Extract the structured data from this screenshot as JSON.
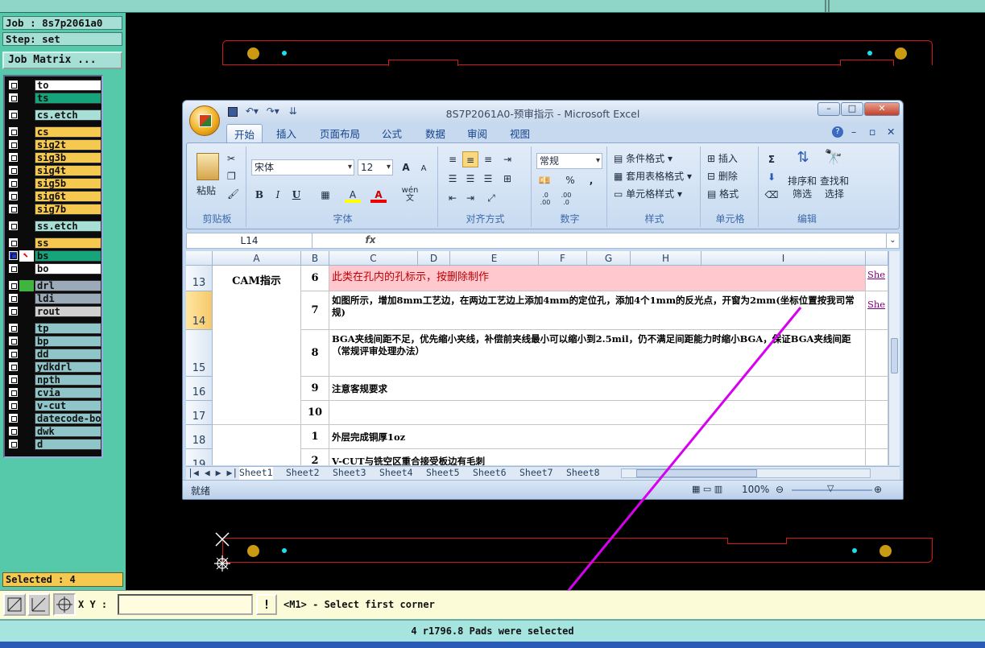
{
  "cam": {
    "job_label": "Job : 8s7p2061a0",
    "step_label": "Step: set",
    "job_matrix_button": "Job Matrix ...",
    "layers": [
      {
        "name": "to",
        "color": "#ffffff"
      },
      {
        "name": "ts",
        "color": "#16a47a"
      },
      {
        "name": "cs.etch",
        "color": "#a6dfd6"
      },
      {
        "name": "cs",
        "color": "#f5c850"
      },
      {
        "name": "sig2t",
        "color": "#f5c850"
      },
      {
        "name": "sig3b",
        "color": "#f5c850"
      },
      {
        "name": "sig4t",
        "color": "#f5c850"
      },
      {
        "name": "sig5b",
        "color": "#f5c850"
      },
      {
        "name": "sig6t",
        "color": "#f5c850"
      },
      {
        "name": "sig7b",
        "color": "#f5c850"
      },
      {
        "name": "ss.etch",
        "color": "#a6dfd6"
      },
      {
        "name": "ss",
        "color": "#f5c850"
      },
      {
        "name": "bs",
        "color": "#16a47a"
      },
      {
        "name": "bo",
        "color": "#ffffff"
      },
      {
        "name": "drl",
        "color": "#9aaab8"
      },
      {
        "name": "ldi",
        "color": "#9aaab8"
      },
      {
        "name": "rout",
        "color": "#d0d0d0"
      },
      {
        "name": "tp",
        "color": "#8fc4c8"
      },
      {
        "name": "bp",
        "color": "#8fc4c8"
      },
      {
        "name": "dd",
        "color": "#8fc4c8"
      },
      {
        "name": "ydkdrl",
        "color": "#8fc4c8"
      },
      {
        "name": "npth",
        "color": "#8fc4c8"
      },
      {
        "name": "cvia",
        "color": "#8fc4c8"
      },
      {
        "name": "v-cut",
        "color": "#8fc4c8"
      },
      {
        "name": "datecode-bo",
        "color": "#8fc4c8"
      },
      {
        "name": "dwk",
        "color": "#8fc4c8"
      },
      {
        "name": "d",
        "color": "#8fc4c8"
      }
    ],
    "selected_label": "Selected : 4",
    "xy_label": "X Y :",
    "xy_value": "",
    "warn_button": "!",
    "prompt": "<M1> - Select first corner",
    "status": "4 r1796.8 Pads were selected",
    "accent": "#d800f0"
  },
  "excel": {
    "window_title": "8S7P2061A0-预审指示 - Microsoft Excel",
    "window_controls": [
      "–",
      "□",
      "✕"
    ],
    "tabs": [
      "开始",
      "插入",
      "页面布局",
      "公式",
      "数据",
      "审阅",
      "视图"
    ],
    "active_tab": "开始",
    "ribbon": {
      "clipboard": {
        "title": "剪贴板",
        "paste": "粘贴"
      },
      "font": {
        "title": "字体",
        "name": "宋体",
        "size": "12",
        "grow": "A",
        "shrink": "A",
        "bold": "B",
        "italic": "I",
        "underline": "U",
        "fill_color": "A",
        "font_color": "A",
        "phonetic": "wén 文"
      },
      "alignment": {
        "title": "对齐方式"
      },
      "number": {
        "title": "数字",
        "format": "常规",
        "percent": "%",
        "comma": ",",
        "inc_decimal": ".0 .00",
        "dec_decimal": ".00 .0"
      },
      "styles": {
        "title": "样式",
        "conditional": "条件格式",
        "table": "套用表格格式",
        "cell": "单元格样式"
      },
      "cells": {
        "title": "单元格",
        "insert": "插入",
        "delete": "删除",
        "format": "格式"
      },
      "editing": {
        "title": "编辑",
        "sigma": "Σ",
        "sort_line1": "排序和",
        "sort_line2": "筛选",
        "find_line1": "查找和",
        "find_line2": "选择"
      }
    },
    "name_box": "L14",
    "fx": "fx",
    "columns": [
      "A",
      "B",
      "C",
      "D",
      "E",
      "F",
      "G",
      "H",
      "I"
    ],
    "rows": [
      {
        "num": "13",
        "b": "6",
        "c": "此类在孔内的孔标示，按删除制作",
        "link": "She"
      },
      {
        "num": "14",
        "b": "7",
        "c": "如图所示，增加8mm工艺边，在两边工艺边上添加4mm的定位孔，添加4个1mm的反光点，开窗为2mm(坐标位置按我司常规)",
        "link": "She"
      },
      {
        "num": "15",
        "b": "8",
        "c": "BGA夹线间距不足，优先缩小夹线，补偿前夹线最小可以缩小到2.5mil，仍不满足间距能力时缩小BGA，保证BGA夹线间距（常规评审处理办法）",
        "link": ""
      },
      {
        "num": "16",
        "b": "9",
        "c": "注意客规要求",
        "link": ""
      },
      {
        "num": "17",
        "b": "10",
        "c": "",
        "link": ""
      },
      {
        "num": "18",
        "b": "1",
        "c": "外层完成铜厚1oz",
        "link": ""
      },
      {
        "num": "19",
        "b": "2",
        "c": "V-CUT与铣空区重合接受板边有毛刺",
        "link": ""
      }
    ],
    "a_cell_cam": "CAM指示",
    "sheets": [
      "Sheet1",
      "Sheet2",
      "Sheet3",
      "Sheet4",
      "Sheet5",
      "Sheet6",
      "Sheet7",
      "Sheet8"
    ],
    "active_sheet": "Sheet1",
    "status_ready": "就绪",
    "zoom": "100%",
    "highlight_color": "#ffc7ce",
    "highlight_text_color": "#c00000"
  }
}
